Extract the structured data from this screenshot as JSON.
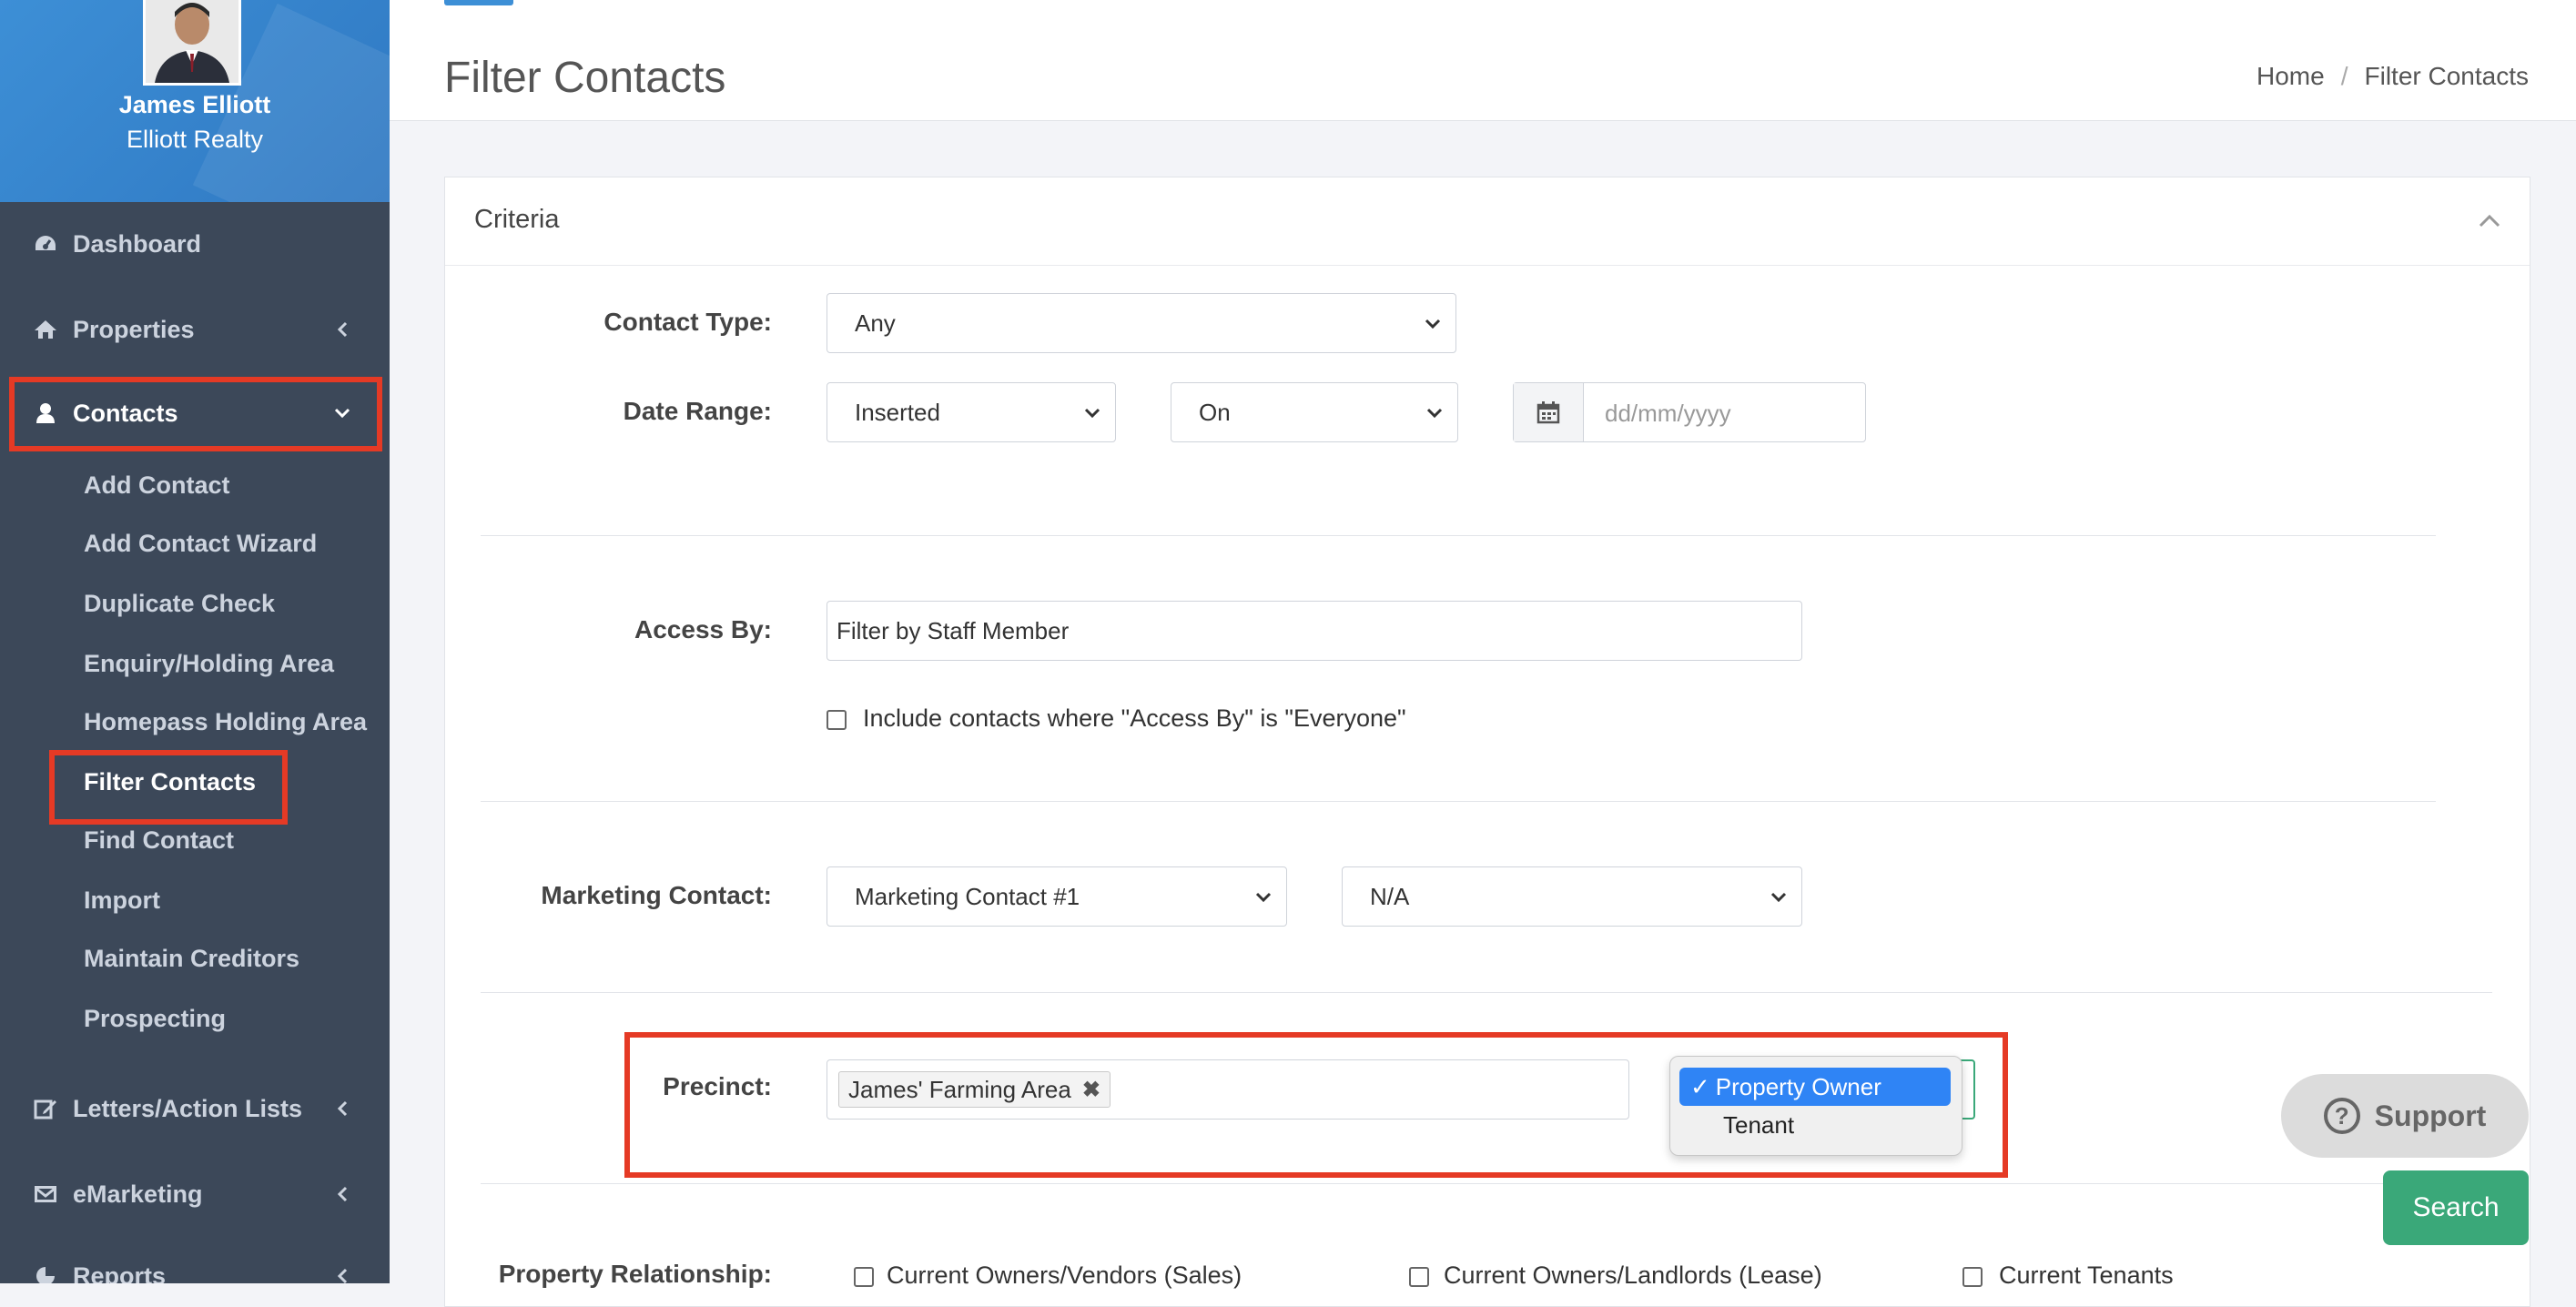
{
  "user": {
    "name": "James Elliott",
    "company": "Elliott Realty"
  },
  "nav": {
    "dashboard": "Dashboard",
    "properties": "Properties",
    "contacts": "Contacts",
    "letters": "Letters/Action Lists",
    "emarketing": "eMarketing",
    "reports": "Reports"
  },
  "contacts_menu": [
    "Add Contact",
    "Add Contact Wizard",
    "Duplicate Check",
    "Enquiry/Holding Area",
    "Homepass Holding Area",
    "Filter Contacts",
    "Find Contact",
    "Import",
    "Maintain Creditors",
    "Prospecting"
  ],
  "page": {
    "title": "Filter Contacts"
  },
  "breadcrumb": {
    "home": "Home",
    "sep": "/",
    "current": "Filter Contacts"
  },
  "card": {
    "title": "Criteria"
  },
  "form": {
    "contact_type_label": "Contact Type:",
    "contact_type_value": "Any",
    "date_range_label": "Date Range:",
    "date_field_value": "Inserted",
    "date_op_value": "On",
    "date_placeholder": "dd/mm/yyyy",
    "access_by_label": "Access By:",
    "access_by_value": "Filter by Staff Member",
    "include_everyone_label": "Include contacts where \"Access By\" is \"Everyone\"",
    "marketing_label": "Marketing Contact:",
    "marketing_value": "Marketing Contact #1",
    "marketing_option_value": "N/A",
    "precinct_label": "Precinct:",
    "precinct_tag": "James' Farming Area",
    "precinct_remove": "✖",
    "precinct_options": [
      "Property Owner",
      "Tenant"
    ],
    "property_rel_label": "Property Relationship:",
    "property_rel_options": [
      "Current Owners/Vendors (Sales)",
      "Current Owners/Landlords (Lease)",
      "Current Tenants"
    ]
  },
  "buttons": {
    "support": "Support",
    "search": "Search"
  },
  "colors": {
    "sidebar": "#3c4859",
    "profile": "#3d8fd6",
    "highlight": "#e53a25",
    "search": "#3aa879",
    "selected_option": "#2f84f5"
  }
}
